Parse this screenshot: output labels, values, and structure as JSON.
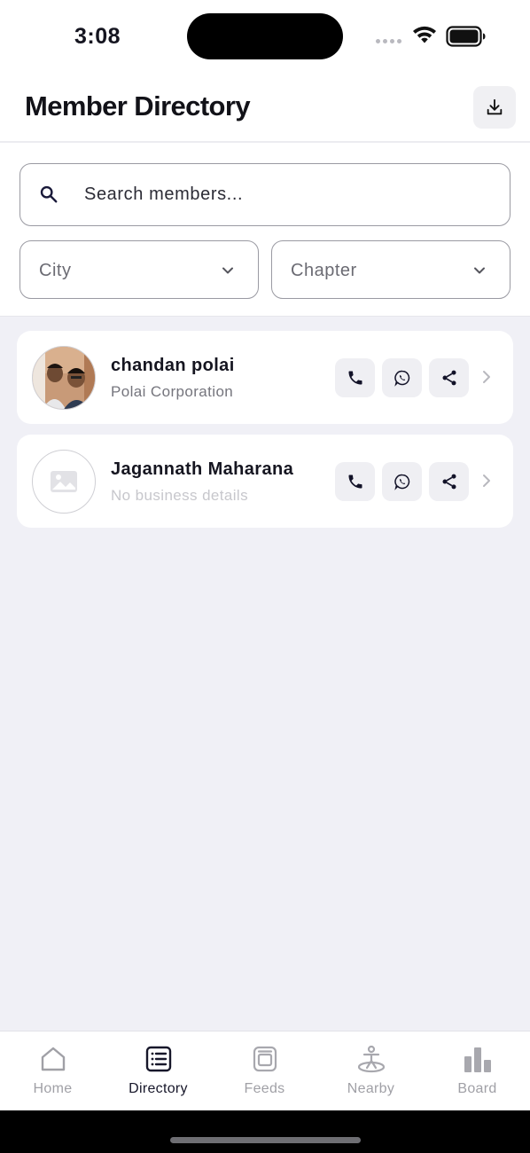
{
  "status_bar": {
    "time": "3:08",
    "icons": [
      "signal-icon",
      "wifi-icon",
      "battery-icon"
    ]
  },
  "header": {
    "title": "Member Directory",
    "download_icon": "download-icon"
  },
  "filters": {
    "search": {
      "placeholder": "Search members...",
      "value": ""
    },
    "city": {
      "label": "City"
    },
    "chapter": {
      "label": "Chapter"
    }
  },
  "members": [
    {
      "name": "chandan polai",
      "company": "Polai Corporation",
      "avatar": "photo",
      "actions": [
        "phone-icon",
        "whatsapp-icon",
        "share-icon"
      ]
    },
    {
      "name": "Jagannath Maharana",
      "company": "No business details",
      "avatar": "placeholder-image-icon",
      "actions": [
        "phone-icon",
        "whatsapp-icon",
        "share-icon"
      ]
    }
  ],
  "nav": {
    "items": [
      {
        "label": "Home",
        "icon": "home-icon",
        "active": false
      },
      {
        "label": "Directory",
        "icon": "directory-icon",
        "active": true
      },
      {
        "label": "Feeds",
        "icon": "feeds-icon",
        "active": false
      },
      {
        "label": "Nearby",
        "icon": "nearby-icon",
        "active": false
      },
      {
        "label": "Board",
        "icon": "board-icon",
        "active": false
      }
    ]
  },
  "colors": {
    "background": "#f0f0f6",
    "card": "#ffffff",
    "text_primary": "#151520",
    "text_secondary": "#75757d",
    "nav_inactive": "#a0a0a6",
    "nav_active": "#17172a"
  }
}
